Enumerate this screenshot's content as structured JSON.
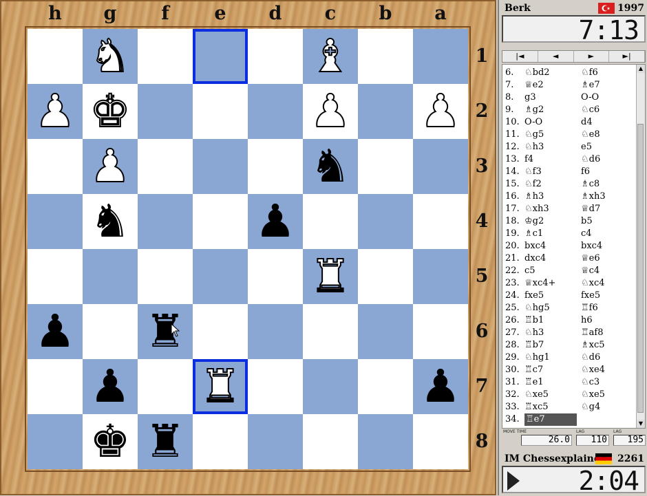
{
  "board": {
    "files": [
      "h",
      "g",
      "f",
      "e",
      "d",
      "c",
      "b",
      "a"
    ],
    "ranks": [
      "1",
      "2",
      "3",
      "4",
      "5",
      "6",
      "7",
      "8"
    ],
    "pieces": [
      {
        "square": "g1",
        "symbol": "♞",
        "side": "white",
        "name": "white-knight"
      },
      {
        "square": "c1",
        "symbol": "♝",
        "side": "white",
        "name": "white-bishop"
      },
      {
        "square": "h2",
        "symbol": "♟",
        "side": "white",
        "name": "white-pawn"
      },
      {
        "square": "g2",
        "symbol": "♚",
        "side": "white",
        "name": "white-king"
      },
      {
        "square": "c2",
        "symbol": "♟",
        "side": "white",
        "name": "white-pawn"
      },
      {
        "square": "a2",
        "symbol": "♟",
        "side": "white",
        "name": "white-pawn"
      },
      {
        "square": "g3",
        "symbol": "♟",
        "side": "white",
        "name": "white-pawn"
      },
      {
        "square": "c3",
        "symbol": "♞",
        "side": "black",
        "name": "black-knight"
      },
      {
        "square": "g4",
        "symbol": "♞",
        "side": "black",
        "name": "black-knight"
      },
      {
        "square": "d4",
        "symbol": "♟",
        "side": "black",
        "name": "black-pawn"
      },
      {
        "square": "c5",
        "symbol": "♜",
        "side": "white",
        "name": "white-rook"
      },
      {
        "square": "h6",
        "symbol": "♟",
        "side": "black",
        "name": "black-pawn"
      },
      {
        "square": "f6",
        "symbol": "♜",
        "side": "black",
        "name": "black-rook"
      },
      {
        "square": "g7",
        "symbol": "♟",
        "side": "black",
        "name": "black-pawn"
      },
      {
        "square": "e7",
        "symbol": "♜",
        "side": "white",
        "name": "white-rook"
      },
      {
        "square": "a7",
        "symbol": "♟",
        "side": "black",
        "name": "black-pawn"
      },
      {
        "square": "g8",
        "symbol": "♚",
        "side": "black",
        "name": "black-king"
      },
      {
        "square": "f8",
        "symbol": "♜",
        "side": "black",
        "name": "black-rook"
      }
    ],
    "highlighted": [
      "e1",
      "e7"
    ],
    "colors": {
      "light": "#ffffff",
      "dark": "#8aa7d4",
      "highlight": "#0a2ee0"
    }
  },
  "top_player": {
    "name": "Berk",
    "rating": "1997",
    "flag": "turkey",
    "clock": "7:13"
  },
  "bottom_player": {
    "name": "IM Chessexplained",
    "rating": "2261",
    "flag": "germany",
    "clock": "2:04"
  },
  "nav_buttons": [
    "|◄",
    "◄",
    "►",
    "►|"
  ],
  "moves": [
    {
      "num": "6.",
      "white": "♘bd2",
      "black": "♘f6"
    },
    {
      "num": "7.",
      "white": "♕e2",
      "black": "♗e7"
    },
    {
      "num": "8.",
      "white": "g3",
      "black": "O-O"
    },
    {
      "num": "9.",
      "white": "♗g2",
      "black": "♘c6"
    },
    {
      "num": "10.",
      "white": "O-O",
      "black": "d4"
    },
    {
      "num": "11.",
      "white": "♘g5",
      "black": "♘e8"
    },
    {
      "num": "12.",
      "white": "♘h3",
      "black": "e5"
    },
    {
      "num": "13.",
      "white": "f4",
      "black": "♘d6"
    },
    {
      "num": "14.",
      "white": "♘f3",
      "black": "f6"
    },
    {
      "num": "15.",
      "white": "♘f2",
      "black": "♗c8"
    },
    {
      "num": "16.",
      "white": "♗h3",
      "black": "♗xh3"
    },
    {
      "num": "17.",
      "white": "♘xh3",
      "black": "♕d7"
    },
    {
      "num": "18.",
      "white": "♔g2",
      "black": "b5"
    },
    {
      "num": "19.",
      "white": "♗c1",
      "black": "c4"
    },
    {
      "num": "20.",
      "white": "bxc4",
      "black": "bxc4"
    },
    {
      "num": "21.",
      "white": "dxc4",
      "black": "♕e6"
    },
    {
      "num": "22.",
      "white": "c5",
      "black": "♕c4"
    },
    {
      "num": "23.",
      "white": "♕xc4+",
      "black": "♘xc4"
    },
    {
      "num": "24.",
      "white": "fxe5",
      "black": "fxe5"
    },
    {
      "num": "25.",
      "white": "♘hg5",
      "black": "♖f6"
    },
    {
      "num": "26.",
      "white": "♖b1",
      "black": "h6"
    },
    {
      "num": "27.",
      "white": "♘h3",
      "black": "♖af8"
    },
    {
      "num": "28.",
      "white": "♖b7",
      "black": "♗xc5"
    },
    {
      "num": "29.",
      "white": "♘hg1",
      "black": "♘d6"
    },
    {
      "num": "30.",
      "white": "♖c7",
      "black": "♘xe4"
    },
    {
      "num": "31.",
      "white": "♖e1",
      "black": "♘c3"
    },
    {
      "num": "32.",
      "white": "♘xe5",
      "black": "♘xe5"
    },
    {
      "num": "33.",
      "white": "♖xc5",
      "black": "♘g4"
    },
    {
      "num": "34.",
      "white": "♖e7",
      "black": ""
    }
  ],
  "stats": [
    {
      "label": "MOVE TIME",
      "value": "26.0"
    },
    {
      "label": "LAG",
      "value": "110"
    },
    {
      "label": "LAG",
      "value": "195"
    }
  ]
}
